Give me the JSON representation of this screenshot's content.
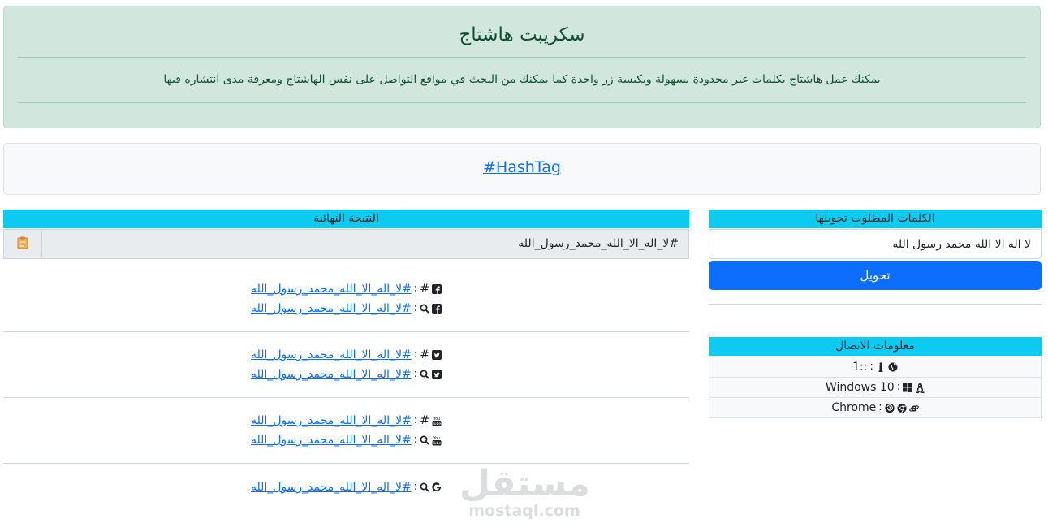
{
  "header": {
    "title": "سكريبت هاشتاج",
    "description": "يمكنك عمل هاشتاج بكلمات غير محدودة بسهولة وبكبسة زر واحدة كما يمكنك من البحث في مواقع التواصل على نفس الهاشتاج ومعرفة مدى انتشاره فيها"
  },
  "hashtag_link": "#HashTag",
  "result": {
    "title": "النتيجة النهائية",
    "value": "#لا_اله_الا_الله_محمد_رسول_الله",
    "copy_icon": "clipboard-icon"
  },
  "links": {
    "facebook": {
      "hashtag": "#لا_اله_الا_الله_محمد_رسول_الله",
      "search": "#لا_اله_الا_الله_محمد_رسول_الله"
    },
    "twitter": {
      "hashtag": "#لا_اله_الا_الله_محمد_رسول_الله",
      "search": "#لا_اله_الا_الله_محمد_رسول_الله"
    },
    "youtube": {
      "hashtag": "#لا_اله_الا_الله_محمد_رسول_الله",
      "search": "#لا_اله_الا_الله_محمد_رسول_الله"
    },
    "google": {
      "search": "#لا_اله_الا_الله_محمد_رسول_الله"
    }
  },
  "labels": {
    "sep": ":",
    "hash": "#",
    "sep_left": ": "
  },
  "input": {
    "title": "الكلمات المطلوب تحويلها",
    "value": "لا اله الا الله محمد رسول الله",
    "button": "تحويل"
  },
  "info": {
    "title": "معلومات الاتصال",
    "ip": "1::",
    "os": "Windows 10",
    "browser": "Chrome"
  },
  "watermark": {
    "arabic": "مستقل",
    "latin": "mostaql.com"
  },
  "colors": {
    "accent": "#0dcaf0",
    "primary": "#0d6efd",
    "success_bg": "#d1e7dd"
  }
}
